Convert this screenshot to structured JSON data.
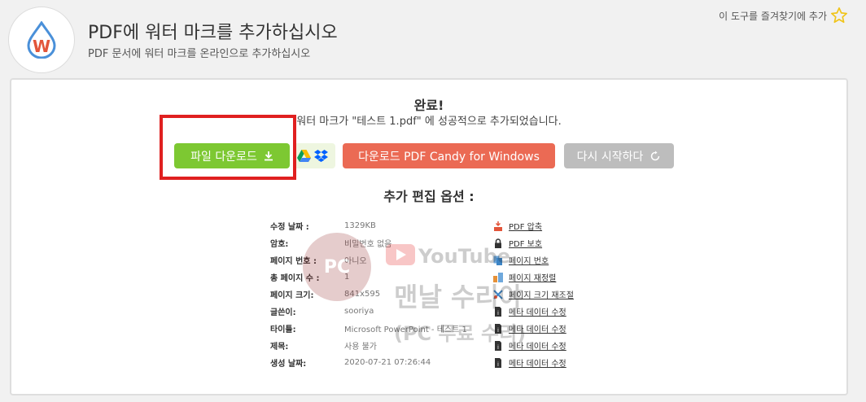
{
  "header": {
    "title": "PDF에 워터 마크를 추가하십시오",
    "subtitle": "PDF 문서에 워터 마크를 온라인으로 추가하십시오",
    "favorite_label": "이 도구를 즐겨찾기에 추가",
    "logo_letter": "W"
  },
  "result": {
    "title": "완료!",
    "message": "워터 마크가 \"테스트 1.pdf\" 에 성공적으로 추가되었습니다."
  },
  "buttons": {
    "download": "파일 다운로드",
    "candy": "다운로드 PDF Candy for Windows",
    "restart": "다시 시작하다"
  },
  "more_options_title": "추가 편집 옵션 :",
  "properties": [
    {
      "label": "수정 날짜 :",
      "value": "1329KB"
    },
    {
      "label": "암호:",
      "value": "비밀번호 없음"
    },
    {
      "label": "페이지 번호 :",
      "value": "아니오"
    },
    {
      "label": "총 페이지 수 :",
      "value": "1"
    },
    {
      "label": "페이지 크기:",
      "value": "841x595"
    },
    {
      "label": "글쓴이:",
      "value": "sooriya"
    },
    {
      "label": "타이틀:",
      "value": "Microsoft PowerPoint - 테스트 1"
    },
    {
      "label": "제목:",
      "value": "사용 불가"
    },
    {
      "label": "생성 날짜:",
      "value": "2020-07-21 07:26:44"
    }
  ],
  "options": [
    {
      "label": "PDF 압축",
      "icon": "compress-icon"
    },
    {
      "label": "PDF 보호",
      "icon": "lock-icon"
    },
    {
      "label": "페이지 번호",
      "icon": "page-number-icon"
    },
    {
      "label": "페이지 재정렬",
      "icon": "reorder-icon"
    },
    {
      "label": "페이지 크기 재조절",
      "icon": "resize-icon"
    },
    {
      "label": "메타 데이터 수정",
      "icon": "metadata-icon"
    },
    {
      "label": "메타 데이터 수정",
      "icon": "metadata-icon"
    },
    {
      "label": "메타 데이터 수정",
      "icon": "metadata-icon"
    },
    {
      "label": "메타 데이터 수정",
      "icon": "metadata-icon"
    }
  ],
  "watermark_overlay": {
    "line1": "PC",
    "line2": "YouTube",
    "line3": "맨날 수리야",
    "line4": "(PC 무료 수리)"
  },
  "colors": {
    "download": "#7dc832",
    "candy": "#eb6a54",
    "restart": "#bdbdbd",
    "highlight": "#e02020"
  }
}
